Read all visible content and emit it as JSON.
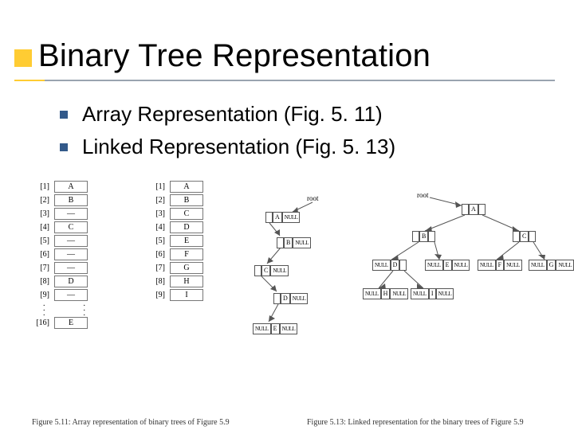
{
  "title": "Binary Tree Representation",
  "bullets": [
    "Array Representation (Fig. 5. 11)",
    "Linked Representation (Fig. 5. 13)"
  ],
  "array_table_left": {
    "rows": [
      {
        "idx": "[1]",
        "val": "A"
      },
      {
        "idx": "[2]",
        "val": "B"
      },
      {
        "idx": "[3]",
        "val": "—"
      },
      {
        "idx": "[4]",
        "val": "C"
      },
      {
        "idx": "[5]",
        "val": "—"
      },
      {
        "idx": "[6]",
        "val": "—"
      },
      {
        "idx": "[7]",
        "val": "—"
      },
      {
        "idx": "[8]",
        "val": "D"
      },
      {
        "idx": "[9]",
        "val": "—"
      }
    ],
    "last": {
      "idx": "[16]",
      "val": "E"
    }
  },
  "array_table_right": {
    "rows": [
      {
        "idx": "[1]",
        "val": "A"
      },
      {
        "idx": "[2]",
        "val": "B"
      },
      {
        "idx": "[3]",
        "val": "C"
      },
      {
        "idx": "[4]",
        "val": "D"
      },
      {
        "idx": "[5]",
        "val": "E"
      },
      {
        "idx": "[6]",
        "val": "F"
      },
      {
        "idx": "[7]",
        "val": "G"
      },
      {
        "idx": "[8]",
        "val": "H"
      },
      {
        "idx": "[9]",
        "val": "I"
      }
    ]
  },
  "linked_left": {
    "root_label": "root",
    "nodes": {
      "A": {
        "left": "",
        "mid": "A",
        "right": "NULL"
      },
      "B": {
        "left": "",
        "mid": "B",
        "right": "NULL"
      },
      "C": {
        "left": "",
        "mid": "C",
        "right": "NULL"
      },
      "D": {
        "left": "",
        "mid": "D",
        "right": "NULL"
      },
      "E": {
        "left": "NULL",
        "mid": "E",
        "right": "NULL"
      }
    }
  },
  "linked_right": {
    "root_label": "root",
    "nodes": {
      "A": {
        "left": "",
        "mid": "A",
        "right": ""
      },
      "B": {
        "left": "",
        "mid": "B",
        "right": ""
      },
      "C": {
        "left": "",
        "mid": "C",
        "right": ""
      },
      "D": {
        "left": "NULL",
        "mid": "D",
        "right": ""
      },
      "E": {
        "left": "NULL",
        "mid": "E",
        "right": "NULL"
      },
      "F": {
        "left": "NULL",
        "mid": "F",
        "right": "NULL"
      },
      "G": {
        "left": "NULL",
        "mid": "G",
        "right": "NULL"
      },
      "H": {
        "left": "NULL",
        "mid": "H",
        "right": "NULL"
      },
      "I": {
        "left": "NULL",
        "mid": "I",
        "right": "NULL"
      }
    }
  },
  "captions": {
    "left": "Figure 5.11: Array representation of binary trees of Figure 5.9",
    "right": "Figure 5.13: Linked representation for the binary trees of Figure 5.9"
  }
}
